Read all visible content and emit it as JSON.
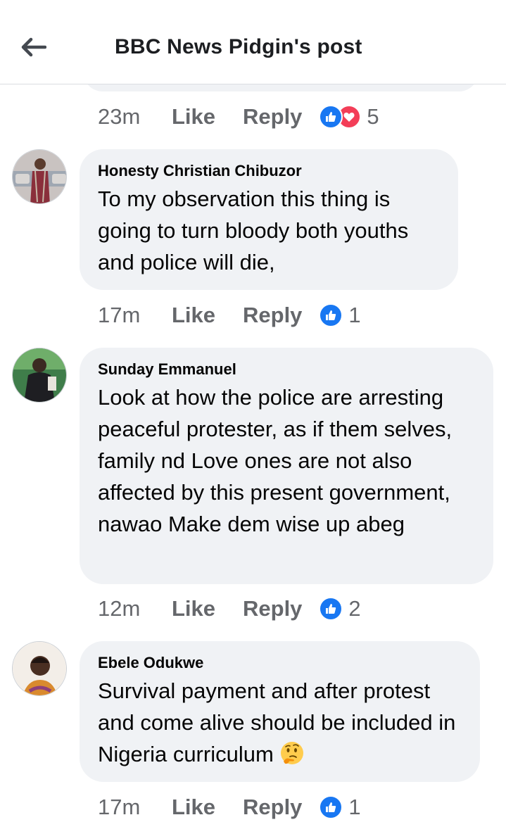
{
  "header": {
    "title": "BBC News Pidgin's post"
  },
  "top_action": {
    "time": "23m",
    "like": "Like",
    "reply": "Reply",
    "count": "5",
    "reactions": [
      "like-icon",
      "love-icon"
    ]
  },
  "comments": [
    {
      "author": "Honesty Christian Chibuzor",
      "text": "To my observation this thing is going to turn bloody both youths and police will die,",
      "time": "17m",
      "like": "Like",
      "reply": "Reply",
      "count": "1"
    },
    {
      "author": "Sunday Emmanuel",
      "text": "Look at how the police are arresting peaceful protester, as if them selves, family nd Love ones are not also affected by this present government, nawao Make dem wise up abeg",
      "time": "12m",
      "like": "Like",
      "reply": "Reply",
      "count": "2"
    },
    {
      "author": "Ebele Odukwe",
      "text": "Survival payment and after protest and come alive should be included in Nigeria curriculum",
      "emoji": "thinking-face-emoji",
      "time": "17m",
      "like": "Like",
      "reply": "Reply",
      "count": "1"
    }
  ],
  "colors": {
    "accent_like": "#1877f2",
    "accent_love": "#f33e58",
    "bubble": "#f0f2f5",
    "meta_text": "#65676b"
  }
}
